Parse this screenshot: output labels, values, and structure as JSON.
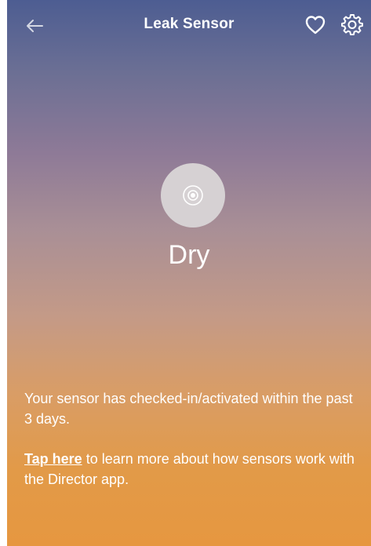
{
  "header": {
    "title": "Leak Sensor",
    "back_icon": "back-arrow-icon",
    "favorite_icon": "heart-icon",
    "settings_icon": "gear-icon"
  },
  "status": {
    "icon": "sensor-icon",
    "label": "Dry"
  },
  "info": {
    "checkin_message": "Your sensor has checked-in/activated within the past 3 days.",
    "tap_link": "Tap here",
    "learn_more_text": " to learn more about how sensors work with the Director app."
  },
  "colors": {
    "gradient_top": "#4d5d92",
    "gradient_middle": "#a98f96",
    "gradient_bottom": "#e69740",
    "status_circle": "#d6d1d3"
  }
}
